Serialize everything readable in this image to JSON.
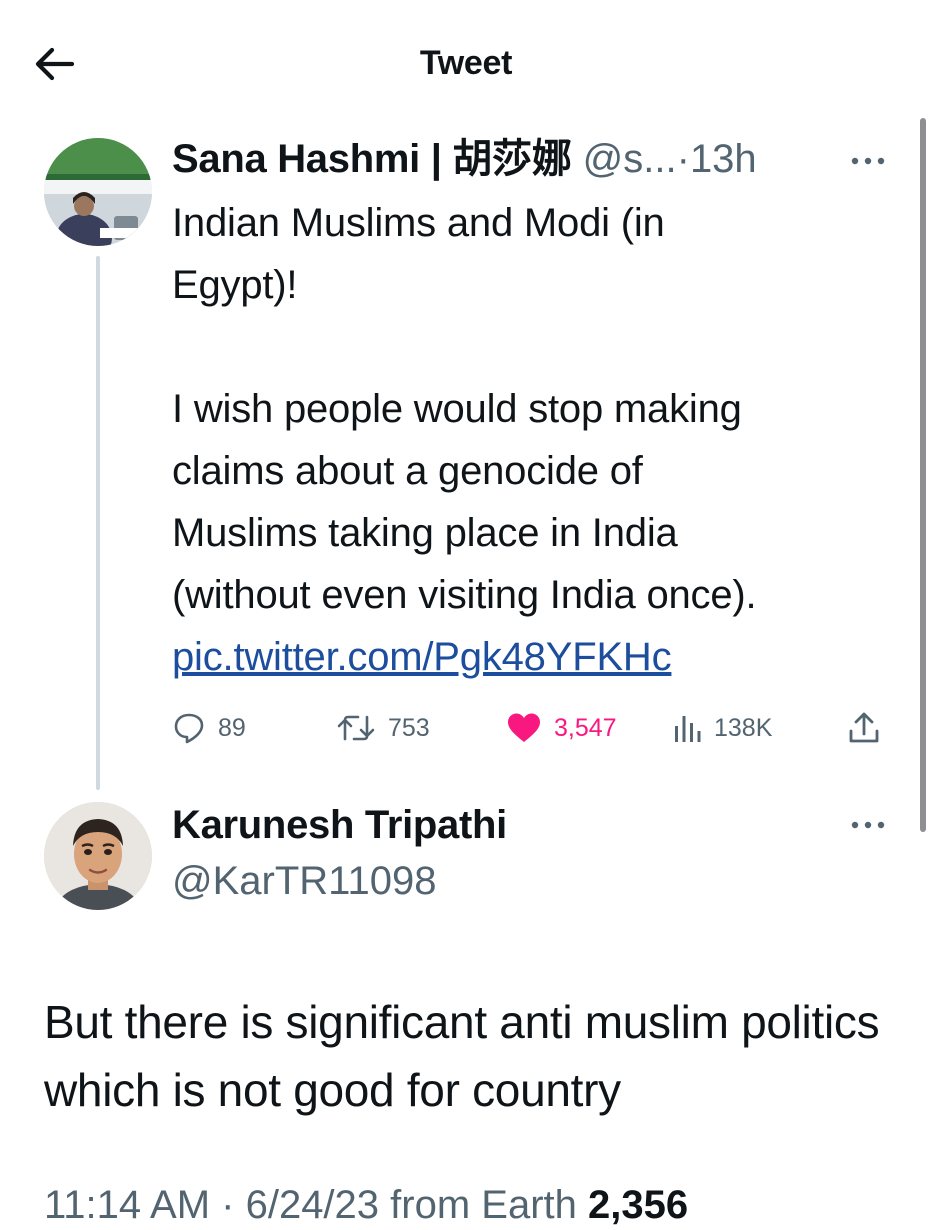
{
  "header": {
    "title": "Tweet"
  },
  "tweet": {
    "author_name": "Sana Hashmi | 胡莎娜",
    "handle": "@s...",
    "separator": "·",
    "time": "13h",
    "text": "Indian Muslims and Modi (in\nEgypt)!\n\nI wish people would stop making\nclaims about a genocide of\nMuslims taking place in India\n(without even visiting India once).\n",
    "link": "pic.twitter.com/Pgk48YFKHc",
    "replies": "89",
    "retweets": "753",
    "likes": "3,547",
    "views": "138K"
  },
  "reply": {
    "author_name": "Karunesh Tripathi",
    "handle": "@KarTR11098",
    "text": "But there is significant anti muslim politics which is not good for country"
  },
  "meta": {
    "timestamp": "11:14 AM · 6/24/23 from Earth",
    "views": "2,356"
  },
  "colors": {
    "like": "#f91880",
    "link": "#1d4e9e",
    "secondary_text": "#536471",
    "thread_line": "#cfd9de"
  }
}
